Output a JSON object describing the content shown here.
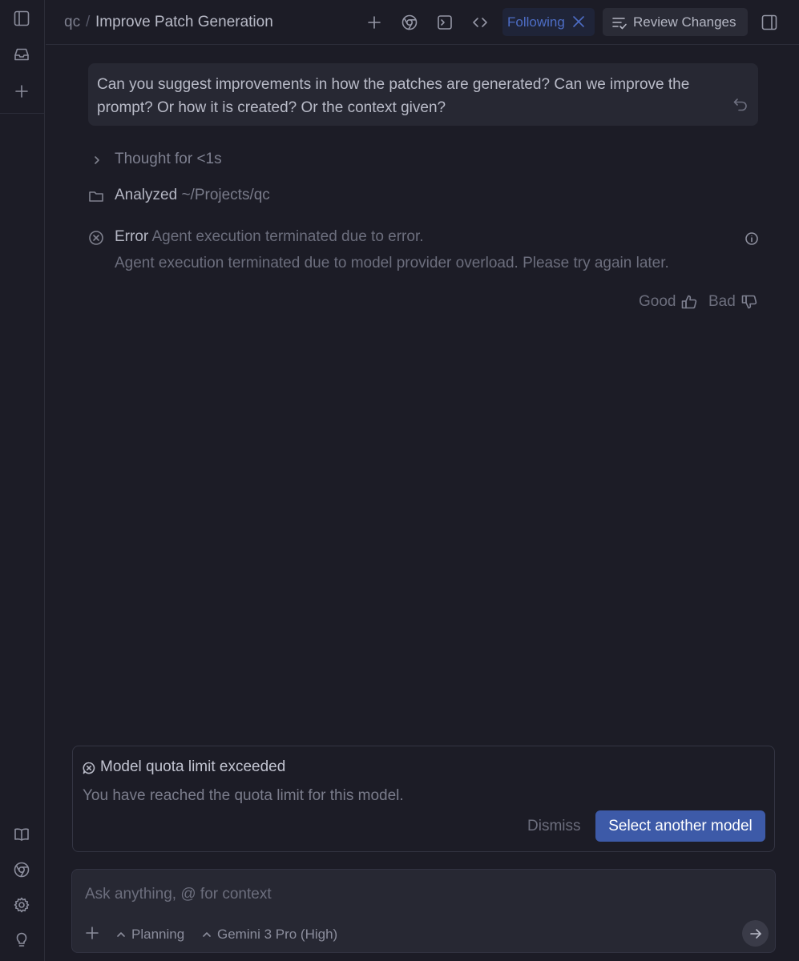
{
  "sidebar": {
    "top_icons": [
      "sidebar-toggle-icon",
      "inbox-icon",
      "plus-icon"
    ],
    "bottom_icons": [
      "book-icon",
      "chrome-icon",
      "gear-icon",
      "lightbulb-icon"
    ]
  },
  "header": {
    "breadcrumb_root": "qc",
    "breadcrumb_sep": "/",
    "title": "Improve Patch Generation",
    "following_label": "Following",
    "review_label": "Review Changes"
  },
  "chat": {
    "user_message": "Can you suggest improvements in how the patches are generated? Can we improve the prompt? Or how it is created? Or the context given?",
    "thought_label": "Thought for <1s",
    "analyzed_label": "Analyzed",
    "analyzed_path": "~/Projects/qc",
    "error_label": "Error",
    "error_summary": "Agent execution terminated due to error.",
    "error_detail": "Agent execution terminated due to model provider overload. Please try again later.",
    "good_label": "Good",
    "bad_label": "Bad"
  },
  "quota_card": {
    "title": "Model quota limit exceeded",
    "description": "You have reached the quota limit for this model.",
    "dismiss_label": "Dismiss",
    "select_label": "Select another model"
  },
  "composer": {
    "placeholder": "Ask anything, @ for context",
    "mode_label": "Planning",
    "model_label": "Gemini 3 Pro (High)"
  },
  "colors": {
    "background": "#1c1c26",
    "accent": "#3d5aa8",
    "following_text": "#4d6dc5"
  }
}
